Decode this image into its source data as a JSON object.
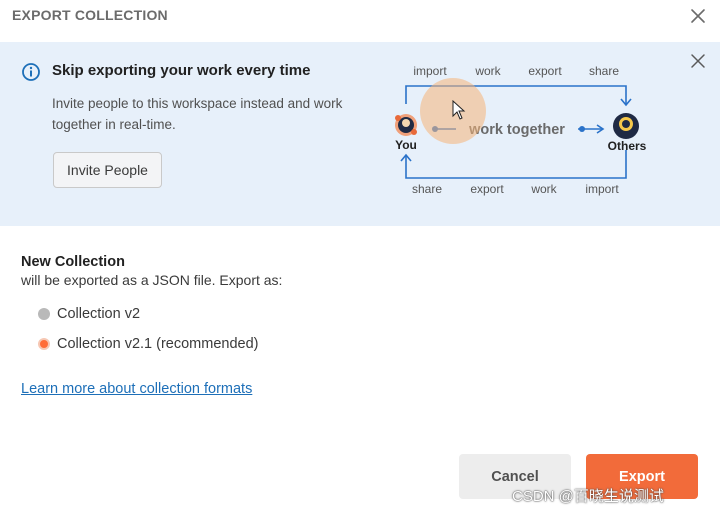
{
  "dialog": {
    "title": "EXPORT COLLECTION"
  },
  "banner": {
    "title": "Skip exporting your work every time",
    "description": "Invite people to this workspace instead and work together in real-time.",
    "invite_label": "Invite People",
    "diagram": {
      "top_labels": [
        "import",
        "work",
        "export",
        "share"
      ],
      "bottom_labels": [
        "share",
        "export",
        "work",
        "import"
      ],
      "center_label": "work together",
      "left_label": "You",
      "right_label": "Others"
    }
  },
  "section": {
    "title": "New Collection",
    "description": "will be exported as a JSON file. Export as:"
  },
  "options": [
    {
      "label": "Collection v2",
      "selected": false
    },
    {
      "label": "Collection v2.1 (recommended)",
      "selected": true
    }
  ],
  "learn_more": "Learn more about collection formats",
  "buttons": {
    "cancel": "Cancel",
    "export": "Export"
  },
  "watermark": "CSDN @百晓生说测试",
  "colors": {
    "accent": "#f26b3a",
    "banner_bg": "#e7f0fa",
    "link": "#1d6fb8"
  }
}
